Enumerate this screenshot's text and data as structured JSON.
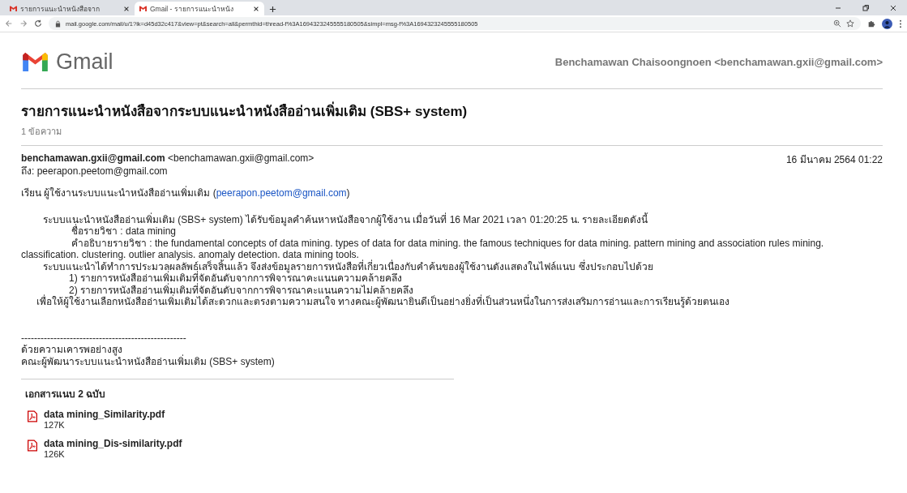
{
  "browser": {
    "tabs": [
      {
        "title": "รายการแนะนำหนังสือจาก",
        "selected": false
      },
      {
        "title": "Gmail - รายการแนะนำหนัง",
        "selected": true
      }
    ],
    "url": "mail.google.com/mail/u/1?ik=d45d32c417&view=pt&search=all&permthid=thread-f%3A1694323245555180505&simpl=msg-f%3A1694323245555180505"
  },
  "header": {
    "logo": "Gmail",
    "account": "Benchamawan Chaisoongnoen <benchamawan.gxii@gmail.com>"
  },
  "thread": {
    "subject": "รายการแนะนำหนังสือจากระบบแนะนำหนังสืออ่านเพิ่มเติม (SBS+ system)",
    "count": "1 ข้อความ"
  },
  "message": {
    "from_name": "benchamawan.gxii@gmail.com",
    "from_address": "<benchamawan.gxii@gmail.com>",
    "to": "ถึง: peerapon.peetom@gmail.com",
    "date": "16 มีนาคม 2564 01:22",
    "greeting": {
      "text": "เรียน ผู้ใช้งานระบบแนะนำหนังสืออ่านเพิ่มเติม (",
      "link": "peerapon.peetom@gmail.com",
      "after": ")"
    },
    "body": [
      {
        "kind": "para",
        "text": "ระบบแนะนำหนังสืออ่านเพิ่มเติม (SBS+ system) ได้รับข้อมูลคำค้นหาหนังสือจากผู้ใช้งาน เมื่อวันที่ 16 Mar 2021 เวลา 01:20:25 น. รายละเอียดดังนี้"
      },
      {
        "kind": "sub",
        "text": "ชื่อรายวิชา : data mining"
      },
      {
        "kind": "sub",
        "text": "คำอธิบายรายวิชา : the fundamental concepts of data mining. types of data for data mining. the famous techniques for data mining. pattern mining and association rules mining. classification. clustering. outlier analysis. anomaly detection. data mining tools."
      },
      {
        "kind": "para",
        "text": "ระบบแนะนำได้ทำการประมวลผลลัพธ์เสร็จสิ้นแล้ว จึงส่งข้อมูลรายการหนังสือที่เกี่ยวเนื่องกับคำค้นของผู้ใช้งานดังแสดงในไฟล์แนบ ซึ่งประกอบไปด้วย"
      },
      {
        "kind": "item",
        "text": "1)  รายการหนังสืออ่านเพิ่มเติมที่จัดอันดับจากการพิจารณาคะแนนความคล้ายคลึง"
      },
      {
        "kind": "item",
        "text": "2)  รายการหนังสืออ่านเพิ่มเติมที่จัดอันดับจากการพิจารณาคะแนนความไม่คล้ายคลึง"
      },
      {
        "kind": "closing",
        "text": "เพื่อให้ผู้ใช้งานเลือกหนังสืออ่านเพิ่มเติมได้สะดวกและตรงตามความสนใจ ทางคณะผู้พัฒนายินดีเป็นอย่างยิ่งที่เป็นส่วนหนึ่งในการส่งเสริมการอ่านและการเรียนรู้ด้วยตนเอง"
      }
    ],
    "signature": [
      "---------------------------------------------------",
      "ด้วยความเคารพอย่างสูง",
      "คณะผู้พัฒนาระบบแนะนำหนังสืออ่านเพิ่มเติม (SBS+ system)"
    ]
  },
  "attachments": {
    "heading": "เอกสารแนบ 2 ฉบับ",
    "files": [
      {
        "name": "data mining_Similarity.pdf",
        "size": "127K"
      },
      {
        "name": "data mining_Dis-similarity.pdf",
        "size": "126K"
      }
    ]
  }
}
